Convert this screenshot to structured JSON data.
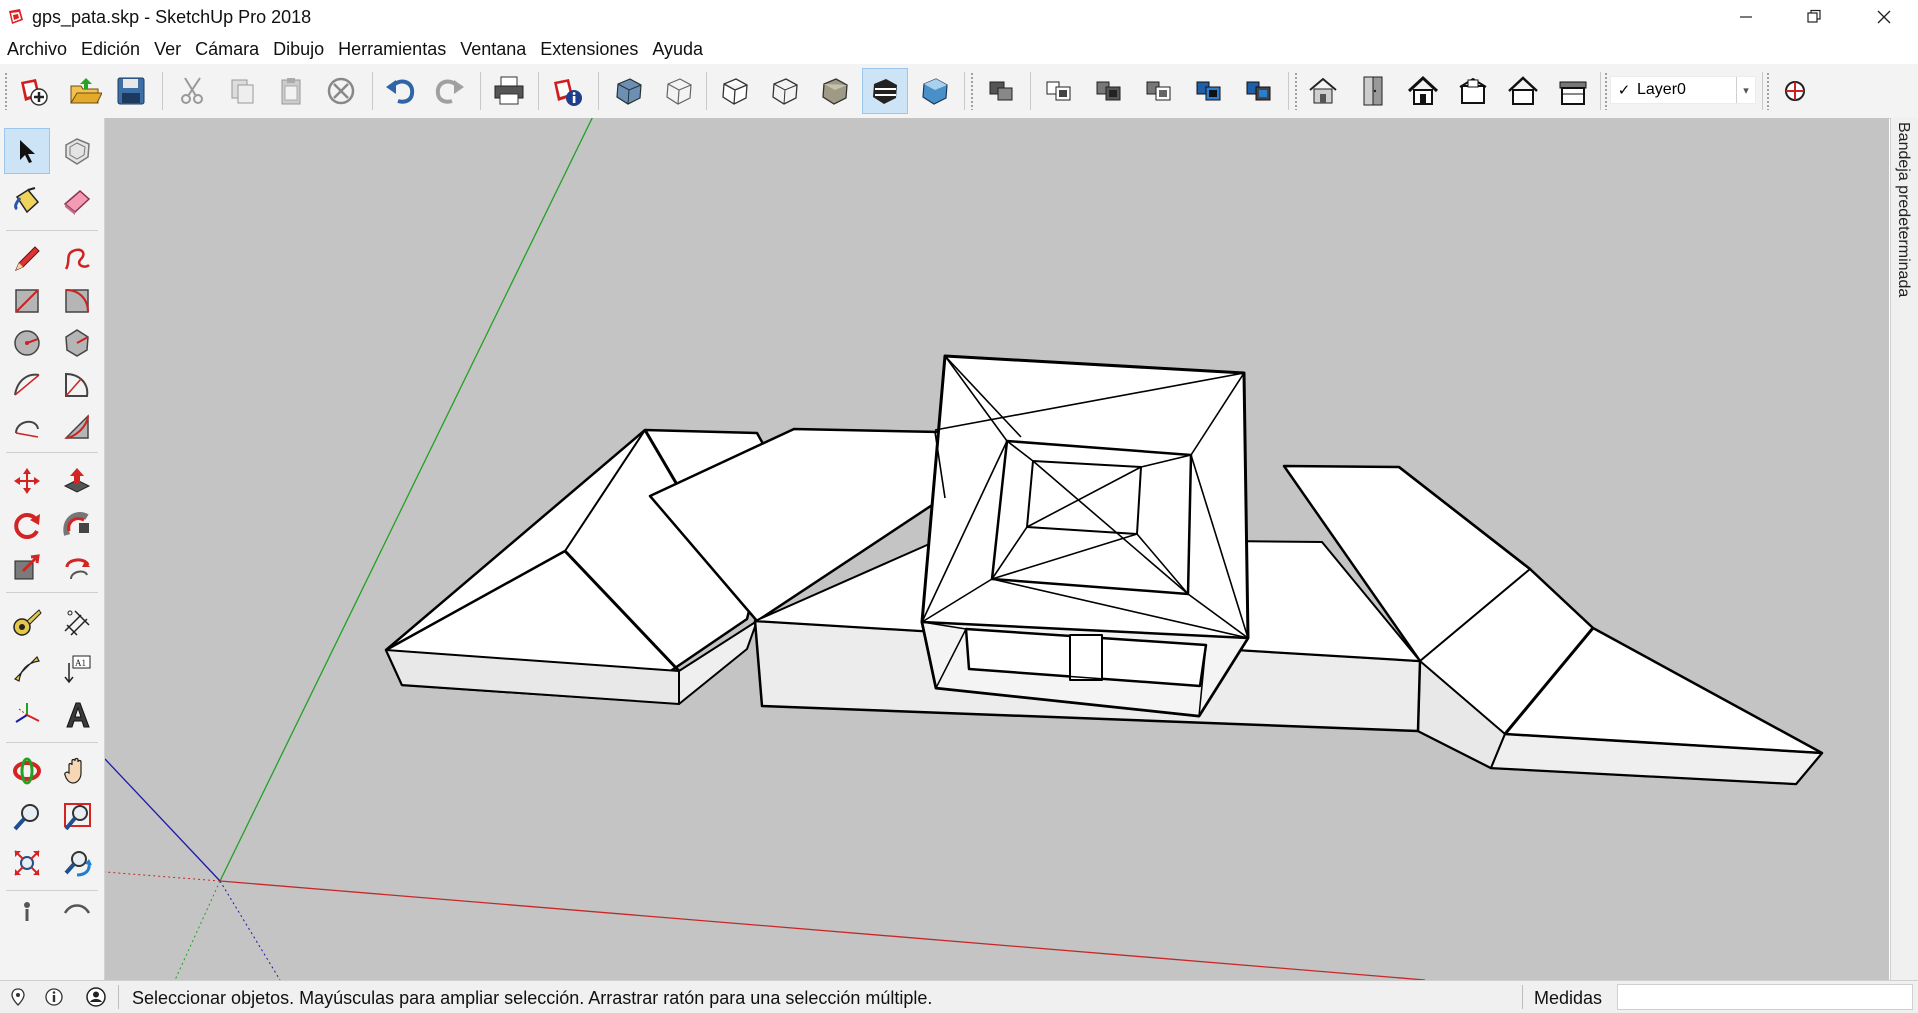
{
  "window": {
    "title": "gps_pata.skp - SketchUp Pro 2018",
    "controls": [
      "minimize-icon",
      "restore-icon",
      "close-icon"
    ]
  },
  "menu": [
    "Archivo",
    "Edición",
    "Ver",
    "Cámara",
    "Dibujo",
    "Herramientas",
    "Ventana",
    "Extensiones",
    "Ayuda"
  ],
  "toolbar": {
    "buttons": [
      "new-file-icon",
      "open-icon",
      "save-icon",
      "cut-icon",
      "copy-icon",
      "paste-icon",
      "erase-icon",
      "undo-icon",
      "redo-icon",
      "print-icon",
      "model-info-icon",
      "xray-icon",
      "wireframe-icon",
      "hidden-line-icon",
      "shaded-icon",
      "shaded-textures-icon",
      "monochrome-icon",
      "iso-view-icon",
      "top-view-icon",
      "front-view-icon",
      "right-view-icon",
      "back-view-icon",
      "left-view-icon",
      "warehouse-icon",
      "components-icon",
      "home-icon",
      "house-front-icon",
      "house-outline-icon",
      "house-roof-icon",
      "geolocation-icon"
    ],
    "active": "monochrome-icon",
    "layer": {
      "checked": "✓",
      "name": "Layer0"
    }
  },
  "left_tools": {
    "groups": [
      [
        "select-icon",
        "make-component-icon",
        "paint-bucket-icon",
        "eraser-icon"
      ],
      [
        "pencil-icon",
        "freehand-icon",
        "rectangle-icon",
        "rotated-rectangle-icon",
        "circle-icon",
        "polygon-icon",
        "arc-icon",
        "pie-icon",
        "two-point-arc-icon",
        "three-point-arc-icon"
      ],
      [
        "move-icon",
        "push-pull-icon",
        "rotate-icon",
        "follow-me-icon",
        "scale-icon",
        "offset-icon"
      ],
      [
        "tape-measure-icon",
        "dimension-icon",
        "protractor-icon",
        "text-icon",
        "axes-icon",
        "3d-text-icon"
      ],
      [
        "orbit-icon",
        "pan-icon",
        "zoom-icon",
        "zoom-window-icon",
        "zoom-extents-icon",
        "previous-view-icon"
      ]
    ],
    "active": "select-icon",
    "text_tool_label": "A1"
  },
  "tray": {
    "label": "Bandeja predeterminada"
  },
  "status": {
    "message": "Seleccionar objetos. Mayúsculas para ampliar selección. Arrastrar ratón para una selección múltiple.",
    "measure_label": "Medidas",
    "measure_value": ""
  },
  "colors": {
    "viewport_bg": "#c4c4c4",
    "axis_red": "#c62828",
    "axis_green": "#22a122",
    "axis_blue": "#1a1aa8",
    "active_button": "#cde4f7"
  }
}
